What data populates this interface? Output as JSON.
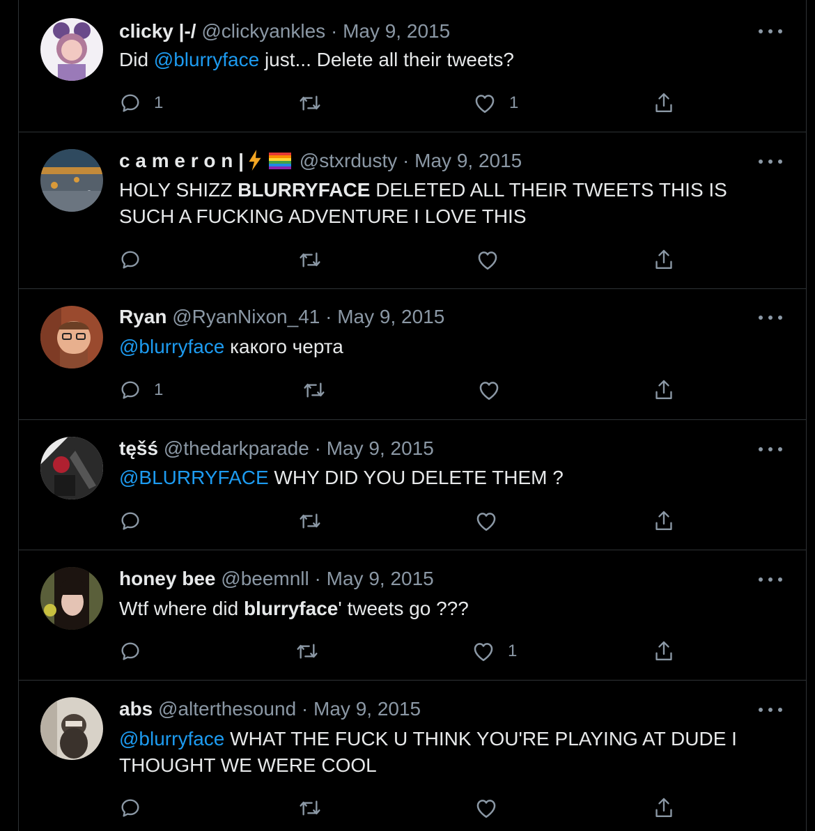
{
  "tweets": [
    {
      "name": "clicky |-/",
      "handle": "@clickyankles",
      "dot": "·",
      "date": "May 9, 2015",
      "segments": [
        {
          "t": "Did ",
          "s": "plain"
        },
        {
          "t": "@blurryface",
          "s": "mention"
        },
        {
          "t": " just... Delete all their tweets?",
          "s": "plain"
        }
      ],
      "replies": "1",
      "retweets": "",
      "likes": "1"
    },
    {
      "name": "c a m e r o n |",
      "handle": "@stxrdusty",
      "dot": "·",
      "date": "May 9, 2015",
      "segments": [
        {
          "t": "HOLY SHIZZ ",
          "s": "plain"
        },
        {
          "t": "BLURRYFACE",
          "s": "bold"
        },
        {
          "t": " DELETED ALL THEIR TWEETS THIS IS SUCH A FUCKING ADVENTURE I LOVE THIS",
          "s": "plain"
        }
      ],
      "replies": "",
      "retweets": "",
      "likes": ""
    },
    {
      "name": "Ryan",
      "handle": "@RyanNixon_41",
      "dot": "·",
      "date": "May 9, 2015",
      "segments": [
        {
          "t": "@blurryface",
          "s": "mention"
        },
        {
          "t": " какого черта",
          "s": "plain"
        }
      ],
      "replies": "1",
      "retweets": "",
      "likes": ""
    },
    {
      "name": "tęšś",
      "handle": "@thedarkparade",
      "dot": "·",
      "date": "May 9, 2015",
      "segments": [
        {
          "t": "@BLURRYFACE",
          "s": "mention"
        },
        {
          "t": " WHY DID YOU DELETE THEM ?",
          "s": "plain"
        }
      ],
      "replies": "",
      "retweets": "",
      "likes": ""
    },
    {
      "name": "honey bee",
      "handle": "@beemnll",
      "dot": "·",
      "date": "May 9, 2015",
      "segments": [
        {
          "t": "Wtf where did ",
          "s": "plain"
        },
        {
          "t": "blurryface",
          "s": "bold"
        },
        {
          "t": "' tweets go ???",
          "s": "plain"
        }
      ],
      "replies": "",
      "retweets": "",
      "likes": "1"
    },
    {
      "name": "abs",
      "handle": "@alterthesound",
      "dot": "·",
      "date": "May 9, 2015",
      "segments": [
        {
          "t": "@blurryface",
          "s": "mention"
        },
        {
          "t": " WHAT THE FUCK U THINK YOU'RE PLAYING AT DUDE I THOUGHT WE WERE COOL",
          "s": "plain"
        }
      ],
      "replies": "",
      "retweets": "",
      "likes": ""
    }
  ],
  "colors": {
    "background": "#000000",
    "text": "#e7e9ea",
    "muted": "#8b98a5",
    "mention": "#1d9bf0",
    "divider": "#2f3336"
  },
  "icons": {
    "reply": "reply-icon",
    "retweet": "retweet-icon",
    "like": "heart-icon",
    "share": "share-icon",
    "more": "more-icon",
    "bolt": "lightning-emoji",
    "rainbow": "rainbow-flag-emoji"
  }
}
